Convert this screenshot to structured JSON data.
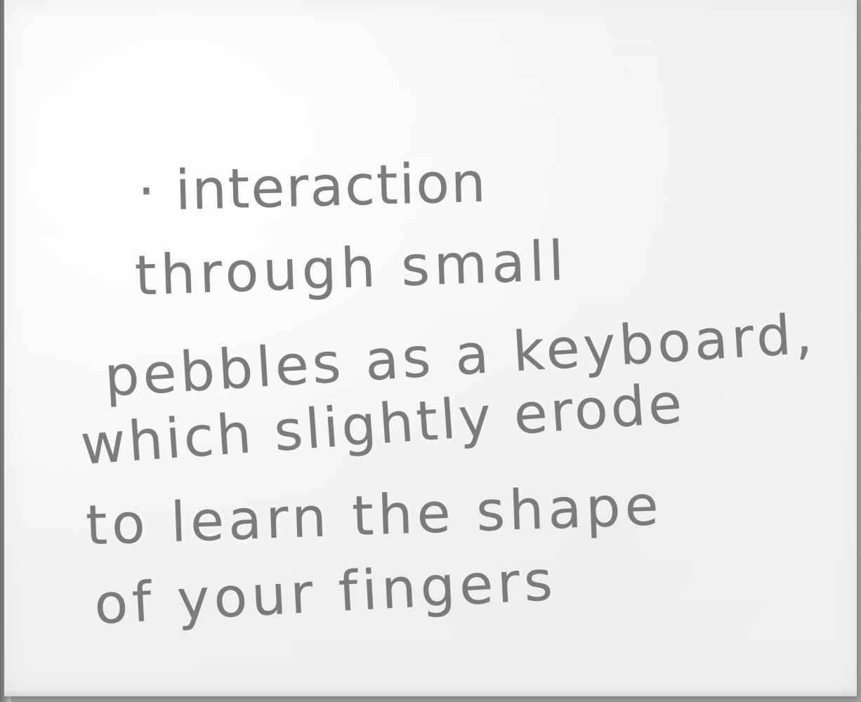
{
  "note": {
    "lines": [
      "· interaction",
      "through small",
      "pebbles as a keyboard,",
      "which slightly erode",
      "to learn the shape",
      "of your fingers"
    ]
  }
}
